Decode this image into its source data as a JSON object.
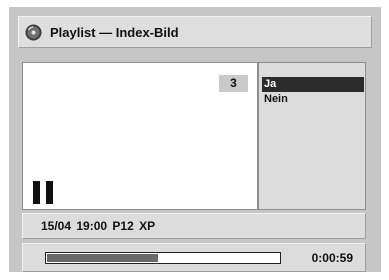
{
  "window": {
    "title": "Playlist — Index-Bild",
    "icon": "disc-icon"
  },
  "preview": {
    "index_number": "3",
    "state_icon": "pause-icon"
  },
  "menu": {
    "items": [
      {
        "label": "Ja",
        "selected": true
      },
      {
        "label": "Nein",
        "selected": false
      }
    ]
  },
  "info": {
    "text": "15/04 19:00 P12 XP"
  },
  "status": {
    "progress_fraction": 0.48,
    "time": "0:00:59"
  },
  "colors": {
    "frame": "#c6c6c6",
    "selected_bg": "#2b2b2b",
    "progress_fill": "#6a6a6a"
  }
}
